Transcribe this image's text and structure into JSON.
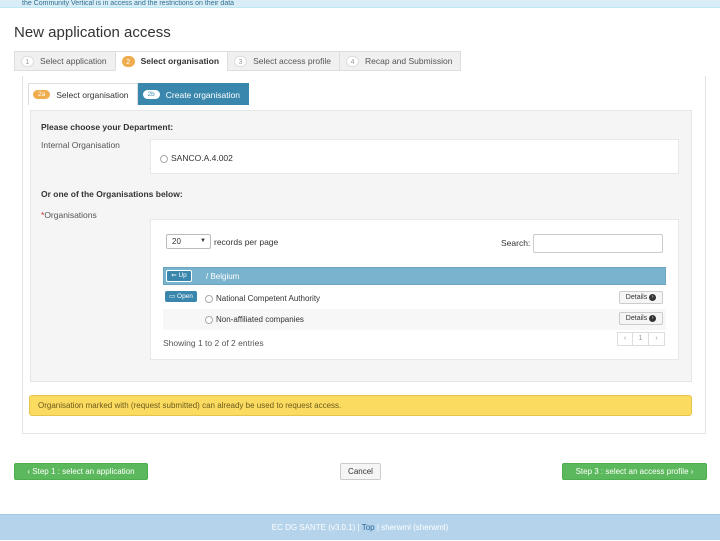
{
  "banner": {
    "text": "the Community Vertical is in access and the restrictions on their data"
  },
  "page": {
    "title": "New application access"
  },
  "steps": [
    {
      "num": "1",
      "label": "Select application"
    },
    {
      "num": "2",
      "label": "Select organisation"
    },
    {
      "num": "3",
      "label": "Select access profile"
    },
    {
      "num": "4",
      "label": "Recap and Submission"
    }
  ],
  "subtabs": [
    {
      "tag": "2a",
      "label": "Select organisation"
    },
    {
      "tag": "2b",
      "label": "Create organisation"
    }
  ],
  "department": {
    "heading": "Please choose your Department:",
    "internal_label": "Internal Organisation",
    "option": "SANCO.A.4.002"
  },
  "organisations": {
    "heading": "Or one of the Organisations below:",
    "required_mark": "*",
    "label": "Organisations",
    "page_size": "20",
    "records_label": "records per page",
    "search_label": "Search:",
    "up_label": "Up",
    "breadcrumb": "/ Belgium",
    "rows": [
      {
        "name": "National Competent Authority",
        "open_label": "Open",
        "details_label": "Details"
      },
      {
        "name": "Non-affiliated companies",
        "details_label": "Details"
      }
    ],
    "showing": "Showing 1 to 2 of 2 entries",
    "pager": {
      "prev": "‹",
      "page": "1",
      "next": "›"
    }
  },
  "warning": {
    "text": "Organisation marked with (request submitted) can already be used to request access."
  },
  "buttons": {
    "back": "Step 1 : select an application",
    "cancel": "Cancel",
    "next": "Step 3 : select an access profile"
  },
  "footer": {
    "version": "EC DG SANTE (v3.0.1) |",
    "top": "Top",
    "user": "| sherwml (sherwml)"
  },
  "colors": {
    "accent": "#3a87ad",
    "active_step": "#f0ad4e",
    "warning": "#fcdc60",
    "success": "#5cb85c"
  }
}
